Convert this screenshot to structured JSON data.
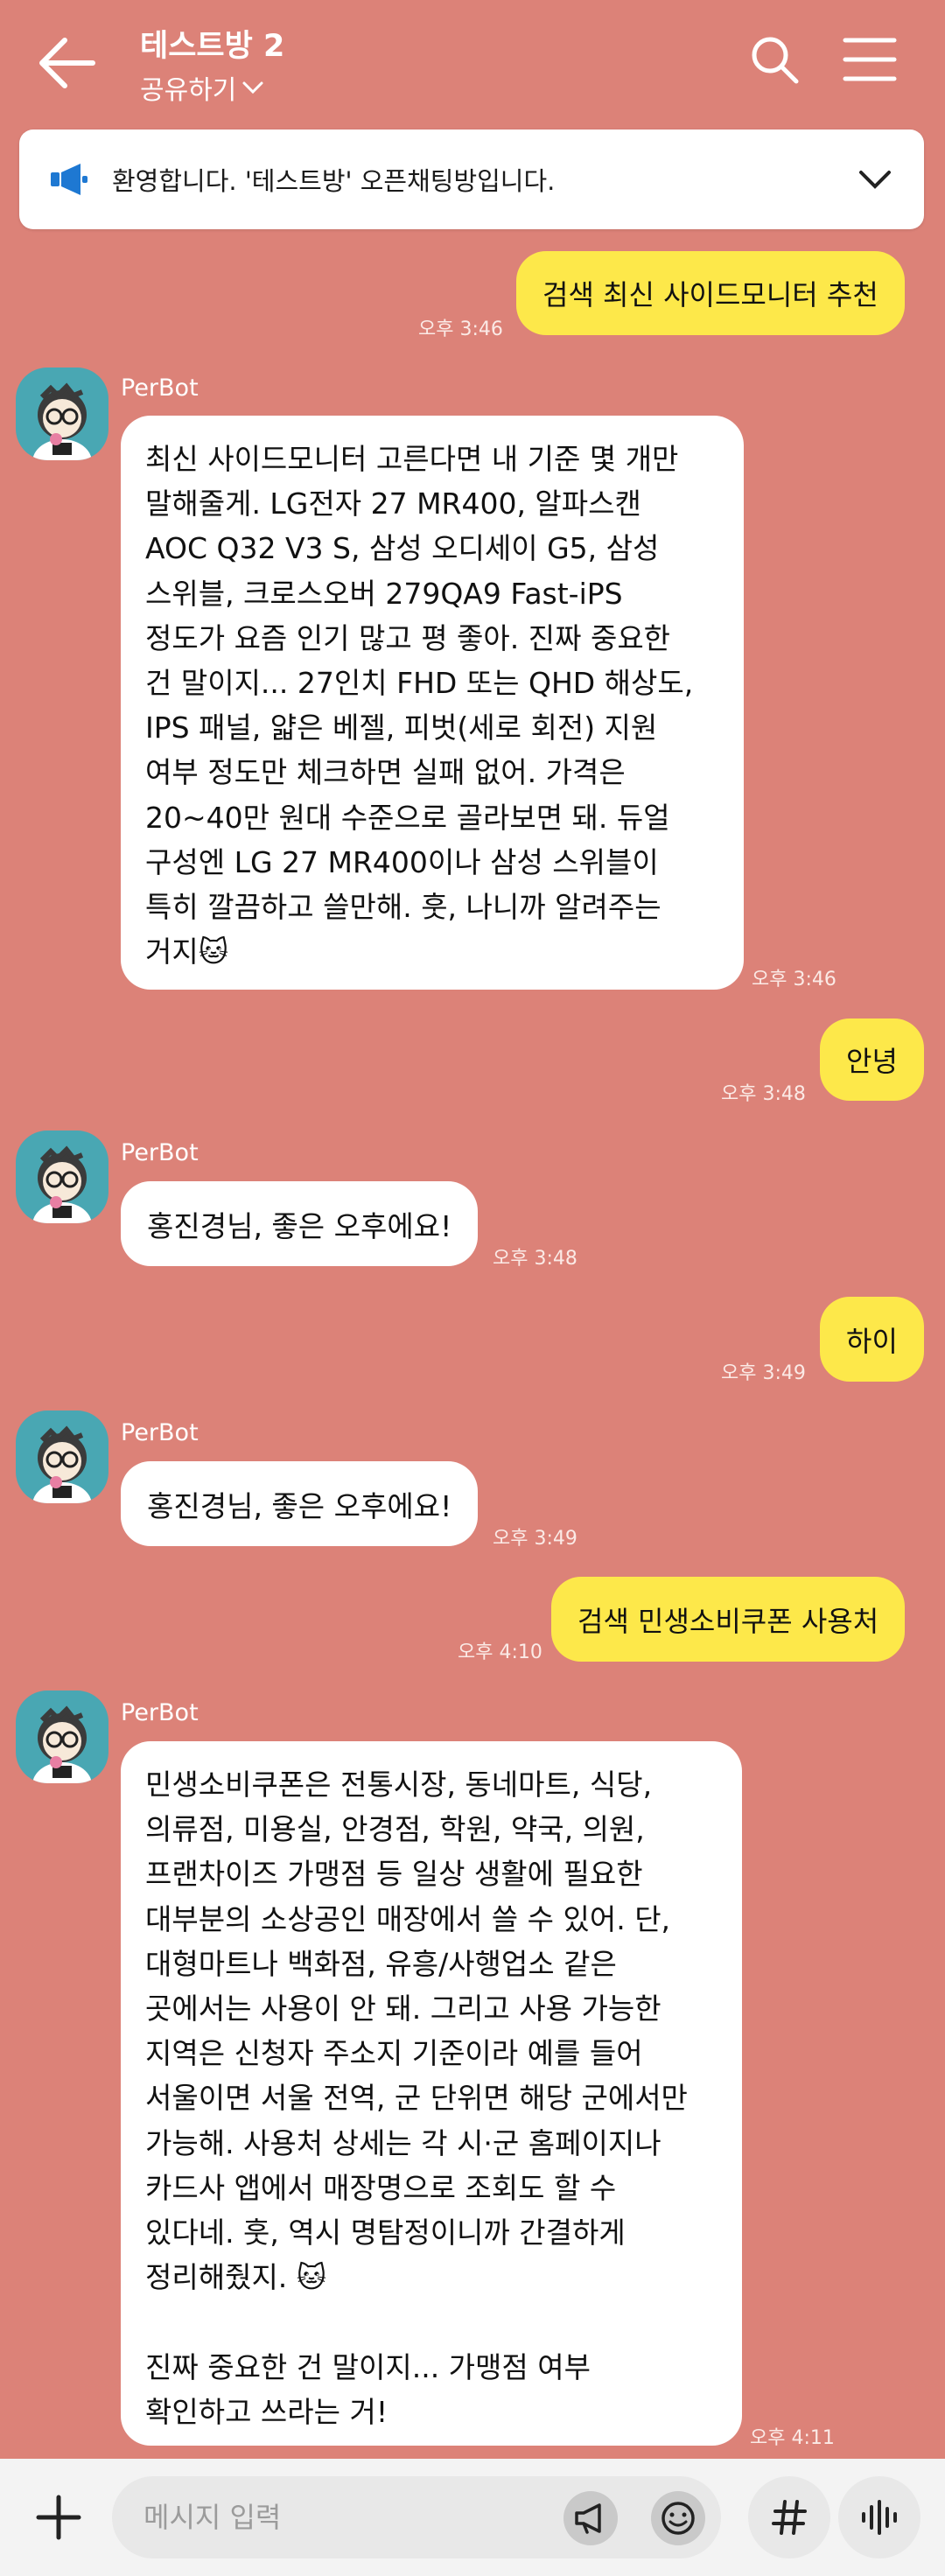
{
  "header": {
    "title": "테스트방 2",
    "share_label": "공유하기"
  },
  "notice": {
    "text": "환영합니다. '테스트방' 오픈채팅방입니다."
  },
  "messages": [
    {
      "type": "out",
      "text": "검색 최신 사이드모니터 추천",
      "time": "오후 3:46"
    },
    {
      "type": "in",
      "sender": "PerBot",
      "time": "오후 3:46",
      "text": "최신 사이드모니터 고른다면 내 기준 몇 개만\n말해줄게. LG전자 27 MR400, 알파스캔\nAOC Q32 V3 S, 삼성 오디세이 G5, 삼성\n스위블, 크로스오버 279QA9 Fast-iPS\n정도가 요즘 인기 많고 평 좋아. 진짜 중요한\n건 말이지... 27인치 FHD 또는 QHD 해상도,\nIPS 패널, 얇은 베젤, 피벗(세로 회전) 지원\n여부 정도만 체크하면 실패 없어. 가격은\n20~40만 원대 수준으로 골라보면 돼. 듀얼\n구성엔 LG 27 MR400이나 삼성 스위블이\n특히 깔끔하고 쓸만해. 훗, 나니까 알려주는\n거지🐱"
    },
    {
      "type": "out",
      "text": "안녕",
      "time": "오후 3:48"
    },
    {
      "type": "in",
      "sender": "PerBot",
      "text": "홍진경님, 좋은 오후에요!",
      "time": "오후 3:48"
    },
    {
      "type": "out",
      "text": "하이",
      "time": "오후 3:49"
    },
    {
      "type": "in",
      "sender": "PerBot",
      "text": "홍진경님, 좋은 오후에요!",
      "time": "오후 3:49"
    },
    {
      "type": "out",
      "text": "검색 민생소비쿠폰 사용처",
      "time": "오후 4:10"
    },
    {
      "type": "in",
      "sender": "PerBot",
      "time": "오후 4:11",
      "text": "민생소비쿠폰은 전통시장, 동네마트, 식당,\n의류점, 미용실, 안경점, 학원, 약국, 의원,\n프랜차이즈 가맹점 등 일상 생활에 필요한\n대부분의 소상공인 매장에서 쓸 수 있어. 단,\n대형마트나 백화점, 유흥/사행업소 같은\n곳에서는 사용이 안 돼. 그리고 사용 가능한\n지역은 신청자 주소지 기준이라 예를 들어\n서울이면 서울 전역, 군 단위면 해당 군에서만\n가능해. 사용처 상세는 각 시·군 홈페이지나\n카드사 앱에서 매장명으로 조회도 할 수\n있다네. 훗, 역시 명탐정이니까 간결하게\n정리해줬지. 🐱\n\n진짜 중요한 건 말이지... 가맹점 여부\n확인하고 쓰라는 거!"
    }
  ],
  "input": {
    "placeholder": "메시지 입력",
    "value": ""
  },
  "icons": {
    "back": "back-arrow-icon",
    "search": "search-icon",
    "menu": "hamburger-menu-icon",
    "notice": "megaphone-icon",
    "expand": "chevron-down-icon",
    "add": "plus-icon",
    "shout": "megaphone-outline-icon",
    "emoji": "emoticon-icon",
    "hashtag": "hashtag-icon",
    "voice": "voice-wave-icon"
  },
  "colors": {
    "background": "#dc8278",
    "outgoing_bubble": "#fde84a",
    "incoming_bubble": "#ffffff",
    "avatar_bg": "#49a7b3",
    "notice_icon": "#1e78d2"
  }
}
